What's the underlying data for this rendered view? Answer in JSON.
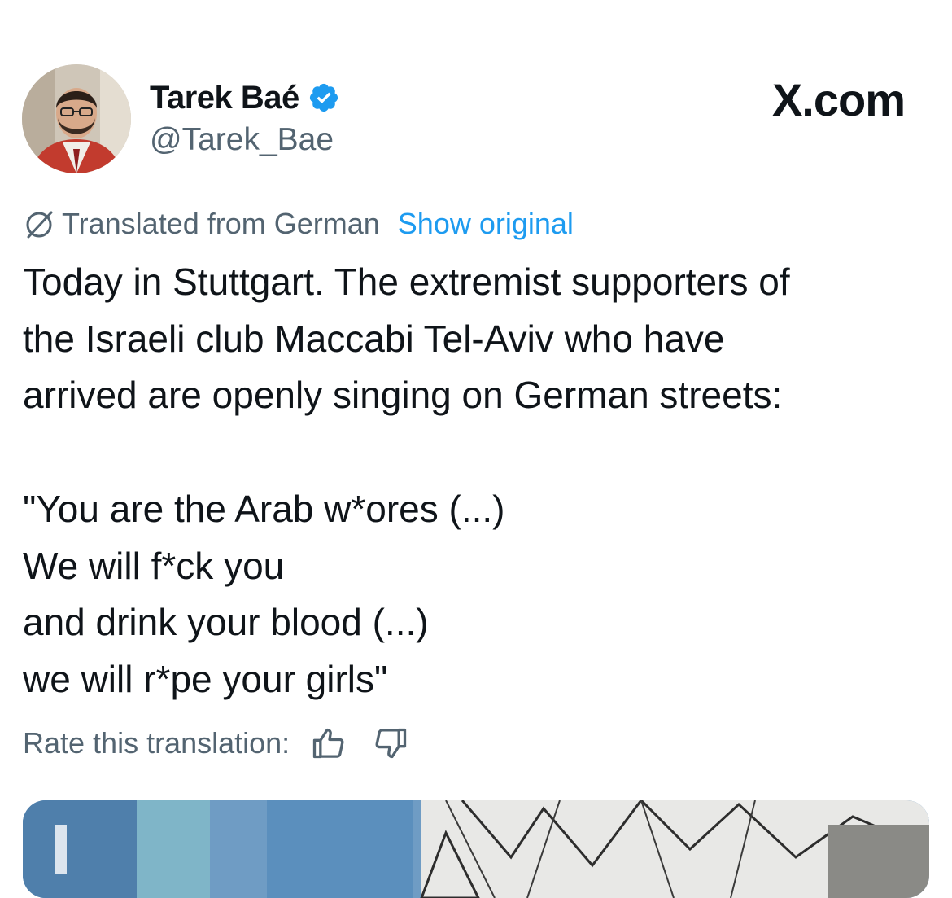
{
  "author": {
    "name": "Tarek Baé",
    "handle": "@Tarek_Bae",
    "verified": true
  },
  "site_logo": "X.com",
  "translation": {
    "label": "Translated from German",
    "show_original": "Show original"
  },
  "tweet": {
    "lines": [
      "Today in Stuttgart. The extremist supporters of",
      "the Israeli club Maccabi Tel-Aviv who have",
      "arrived are openly singing on German streets:",
      "",
      "\"You are the Arab w*ores (...)",
      "We will f*ck you",
      "and drink your blood (...)",
      "we will r*pe your girls\""
    ]
  },
  "rate": {
    "label": "Rate this translation:",
    "up_icon": "thumbs-up-icon",
    "down_icon": "thumbs-down-icon"
  },
  "colors": {
    "text": "#0f1419",
    "secondary": "#536471",
    "accent": "#1d9bf0"
  }
}
